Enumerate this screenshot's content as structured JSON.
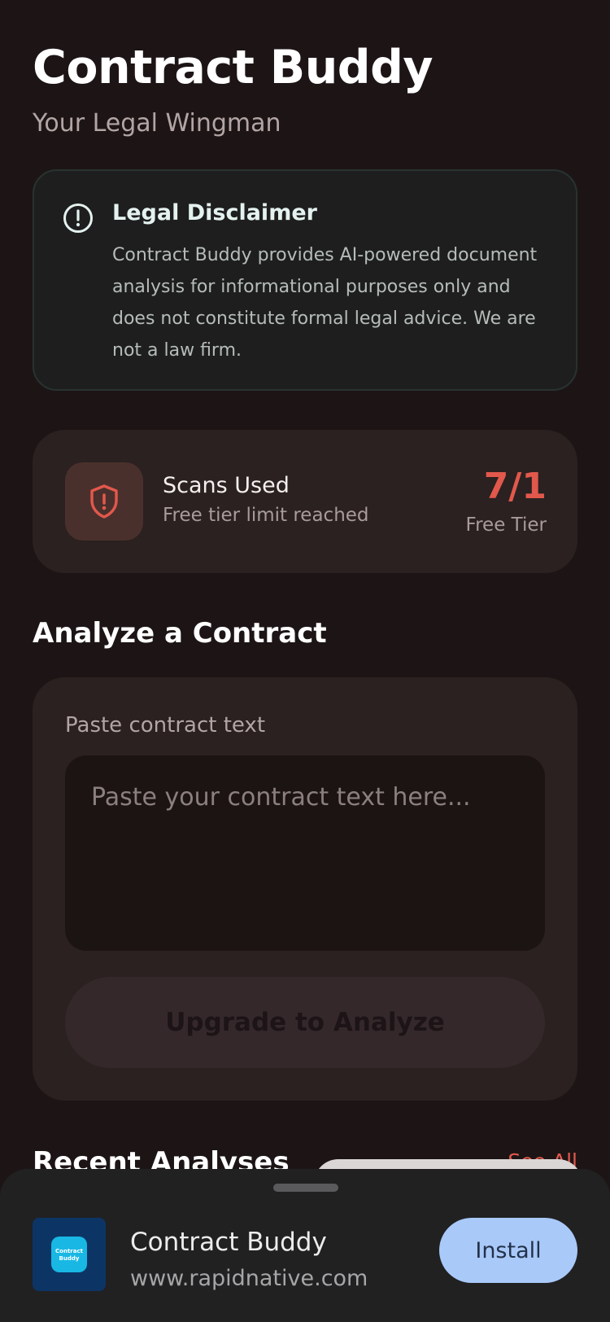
{
  "header": {
    "title": "Contract Buddy",
    "subtitle": "Your Legal Wingman"
  },
  "disclaimer": {
    "icon": "alert-circle-icon",
    "title": "Legal Disclaimer",
    "text": "Contract Buddy provides AI-powered document analysis for informational purposes only and does not constitute formal legal advice. We are not a law firm."
  },
  "scans": {
    "icon": "shield-alert-icon",
    "label": "Scans Used",
    "status": "Free tier limit reached",
    "count": "7/1",
    "tier": "Free Tier"
  },
  "analyze": {
    "section_title": "Analyze a Contract",
    "input_label": "Paste contract text",
    "input_placeholder": "Paste your contract text here...",
    "input_value": "",
    "button_label": "Upgrade to Analyze"
  },
  "recent": {
    "title": "Recent Analyses",
    "see_all": "See All"
  },
  "install_banner": {
    "app_name": "Contract Buddy",
    "url": "www.rapidnative.com",
    "icon_line1": "Contract",
    "icon_line2": "Buddy",
    "button_label": "Install"
  },
  "colors": {
    "background": "#1d1515",
    "card": "#2a2120",
    "accent": "#e2584c",
    "install_button": "#a9c9f9"
  }
}
